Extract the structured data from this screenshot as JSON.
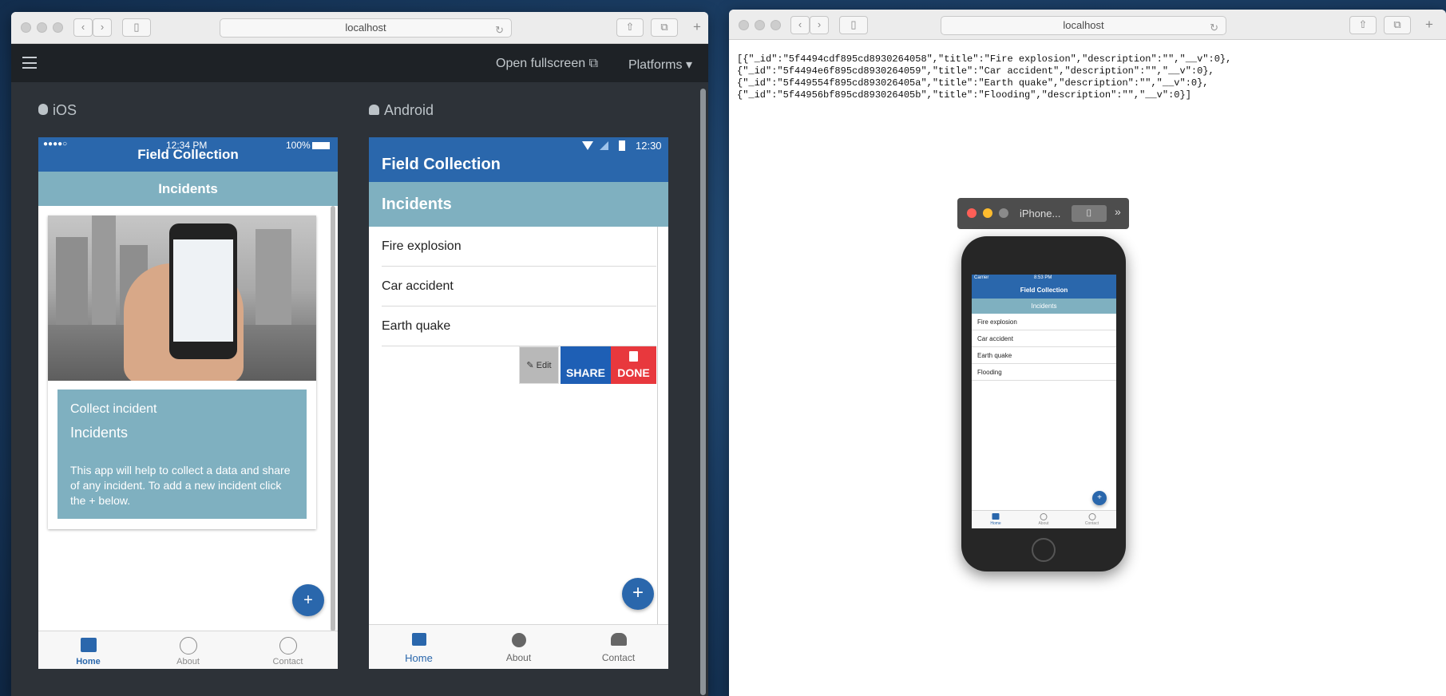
{
  "left_browser": {
    "url": "localhost",
    "header": {
      "open_fullscreen": "Open fullscreen",
      "platforms": "Platforms"
    },
    "platform_labels": {
      "ios": "iOS",
      "android": "Android"
    }
  },
  "ios_app": {
    "status": {
      "carrier": "●●●●○",
      "time": "12:34 PM",
      "battery": "100%"
    },
    "title": "Field Collection",
    "subtitle": "Incidents",
    "card": {
      "label": "Collect incident",
      "heading": "Incidents",
      "description": "This app will help to collect a data and share of any incident. To add a new incident click the + below."
    },
    "fab": "+",
    "tabs": [
      {
        "label": "Home"
      },
      {
        "label": "About"
      },
      {
        "label": "Contact"
      }
    ]
  },
  "android_app": {
    "status": {
      "time": "12:30"
    },
    "title": "Field Collection",
    "subtitle": "Incidents",
    "items": [
      "Fire explosion",
      "Car accident",
      "Earth quake"
    ],
    "actions": {
      "edit": "Edit",
      "share": "SHARE",
      "done": "DONE"
    },
    "fab": "+",
    "tabs": [
      {
        "label": "Home"
      },
      {
        "label": "About"
      },
      {
        "label": "Contact"
      }
    ]
  },
  "right_browser": {
    "url": "localhost",
    "json_lines": [
      "[{\"_id\":\"5f4494cdf895cd8930264058\",\"title\":\"Fire explosion\",\"description\":\"\",\"__v\":0},",
      "{\"_id\":\"5f4494e6f895cd8930264059\",\"title\":\"Car accident\",\"description\":\"\",\"__v\":0},",
      "{\"_id\":\"5f449554f895cd893026405a\",\"title\":\"Earth quake\",\"description\":\"\",\"__v\":0},",
      "{\"_id\":\"5f44956bf895cd893026405b\",\"title\":\"Flooding\",\"description\":\"\",\"__v\":0}]"
    ]
  },
  "simulator": {
    "title": "iPhone...",
    "status": {
      "carrier": "Carrier",
      "time": "8:53 PM"
    },
    "app_title": "Field Collection",
    "subtitle": "Incidents",
    "items": [
      "Fire explosion",
      "Car accident",
      "Earth quake",
      "Flooding"
    ],
    "fab": "+",
    "tabs": [
      {
        "label": "Home"
      },
      {
        "label": "About"
      },
      {
        "label": "Contact"
      }
    ]
  },
  "colors": {
    "brand_blue": "#2a67ac",
    "teal": "#7fb0c0",
    "share": "#1e5fb5",
    "done": "#e8383d"
  }
}
